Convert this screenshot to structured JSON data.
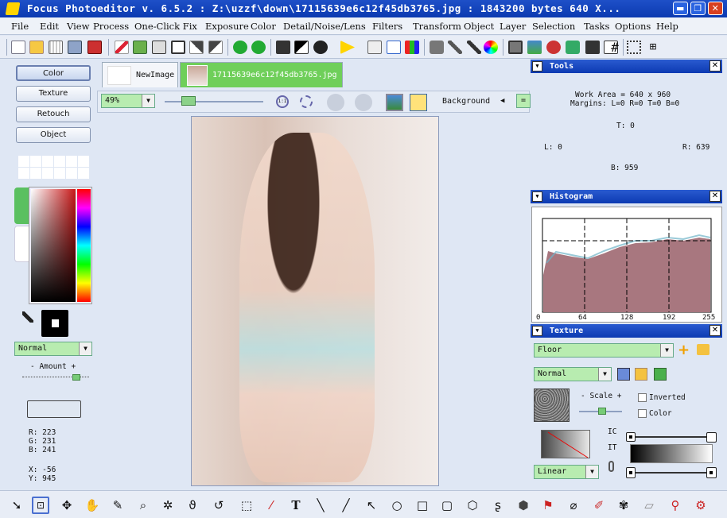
{
  "window": {
    "title": "Focus Photoeditor v. 6.5.2 :  Z:\\uzzf\\down\\17115639e6c12f45db3765.jpg : 1843200 bytes     640 X...",
    "controls": {
      "minimize": "▬",
      "restore": "❐",
      "close": "✕"
    }
  },
  "menu": [
    "File",
    "Edit",
    "View",
    "Process",
    "One-Click Fix",
    "Exposure",
    "Color",
    "Detail/Noise/Lens",
    "Filters",
    "Transform",
    "Object",
    "Layer",
    "Selection",
    "Tasks",
    "Options",
    "Help"
  ],
  "left_panel": {
    "mode_buttons": [
      "Color",
      "Texture",
      "Retouch",
      "Object"
    ],
    "blend_mode": "Normal",
    "amount_label": "- Amount +",
    "amount_value": 0.85,
    "readout": {
      "r": "R: 223",
      "g": "G: 231",
      "b": "B: 241",
      "x": "X: -56",
      "y": "Y: 945"
    }
  },
  "tabs": [
    {
      "label": "NewImage",
      "active": false
    },
    {
      "label": "17115639e6c12f45db3765.jpg",
      "active": true
    }
  ],
  "view_bar": {
    "zoom": "49%",
    "background_label": "Background",
    "zoom_slider": 0.2,
    "fit_label": "1:1"
  },
  "tools_panel": {
    "title": "Tools",
    "work_area": "Work Area = 640 x 960",
    "margins": "Margins: L=0 R=0 T=0 B=0",
    "top": "T: 0",
    "left": "L: 0",
    "right": "R: 639",
    "bottom": "B: 959"
  },
  "histogram_panel": {
    "title": "Histogram",
    "axis_ticks": [
      "0",
      "64",
      "128",
      "192",
      "255"
    ]
  },
  "texture_panel": {
    "title": "Texture",
    "texture_name": "Floor",
    "blend_mode": "Normal",
    "scale_label": "- Scale +",
    "scale_value": 0.55,
    "inverted_label": "Inverted",
    "color_label": "Color",
    "gradient_type": "Linear",
    "side_labels": {
      "ic": "IC",
      "it": "IT"
    }
  },
  "icons": {
    "bottom_tools": [
      "pointer-icon",
      "crop-select-icon",
      "move-icon",
      "hand-icon",
      "brush-select-icon",
      "magic-wand-icon",
      "smart-wand-icon",
      "lasso-icon",
      "free-lasso-icon",
      "rect-select-icon",
      "eyedropper-icon",
      "text-icon",
      "brush-line-icon",
      "line-icon",
      "arrow-icon",
      "circle-icon",
      "square-icon",
      "rounded-rect-icon",
      "hexagon-icon",
      "squiggle-icon",
      "fill-icon",
      "spray-icon",
      "eraser-icon",
      "stamp-icon",
      "heal-icon",
      "smudge-icon",
      "stamp2-icon",
      "paint-icon"
    ]
  },
  "colors": {
    "title_bar": "#0b3ab0",
    "accent_green": "#b8ecb0",
    "panel_bg": "#dfe7f4"
  }
}
